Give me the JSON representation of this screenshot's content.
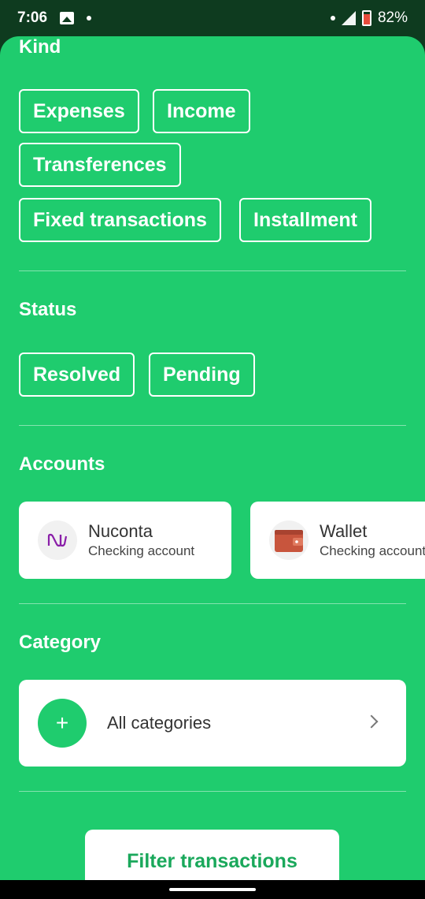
{
  "status_bar": {
    "time": "7:06",
    "battery": "82%"
  },
  "kind": {
    "title": "Kind",
    "chips": [
      "Expenses",
      "Income",
      "Transferences",
      "Fixed transactions",
      "Installment"
    ]
  },
  "status": {
    "title": "Status",
    "chips": [
      "Resolved",
      "Pending"
    ]
  },
  "accounts": {
    "title": "Accounts",
    "items": [
      {
        "name": "Nuconta",
        "type": "Checking account",
        "icon": "nubank-logo-icon"
      },
      {
        "name": "Wallet",
        "type": "Checking account",
        "icon": "wallet-icon"
      }
    ]
  },
  "category": {
    "title": "Category",
    "label": "All categories"
  },
  "filter_button": {
    "label": "Filter transactions"
  },
  "colors": {
    "primary": "#1fcc6e",
    "accent_text": "#1aa85b"
  }
}
